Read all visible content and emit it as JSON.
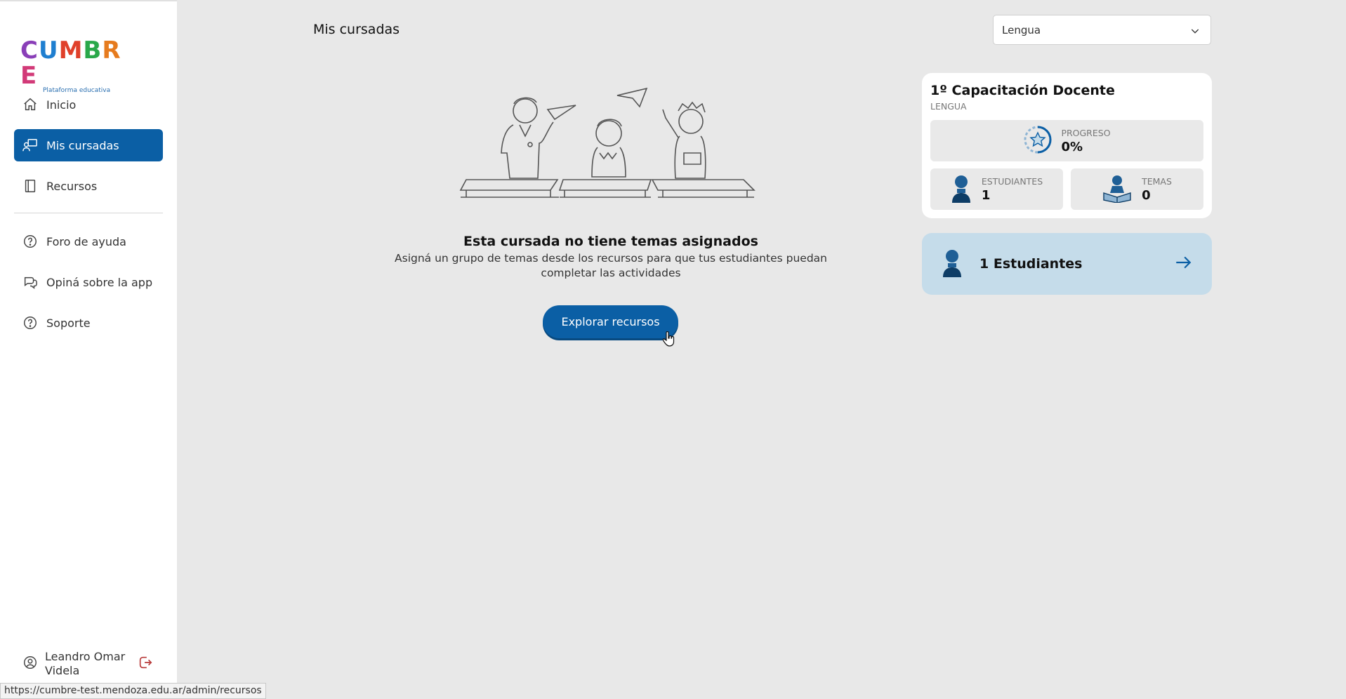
{
  "sidebar": {
    "logo": {
      "text": "CUMBRE",
      "subtitle": "Plataforma educativa"
    },
    "items": [
      {
        "label": "Inicio",
        "icon": "home-icon"
      },
      {
        "label": "Mis cursadas",
        "icon": "classroom-icon",
        "active": true
      },
      {
        "label": "Recursos",
        "icon": "book-icon"
      },
      {
        "label": "Foro de ayuda",
        "icon": "help-icon"
      },
      {
        "label": "Opiná sobre la app",
        "icon": "chat-icon"
      },
      {
        "label": "Soporte",
        "icon": "help-icon"
      }
    ],
    "user": {
      "name": "Leandro Omar Videla"
    }
  },
  "header": {
    "title": "Mis cursadas",
    "subject_select": {
      "value": "Lengua"
    }
  },
  "empty_state": {
    "title": "Esta cursada no tiene temas asignados",
    "description": "Asigná un grupo de temas desde los recursos para que tus estudiantes puedan completar las actividades",
    "button_label": "Explorar recursos"
  },
  "course": {
    "title": "1º Capacitación Docente",
    "subject": "LENGUA",
    "progress": {
      "label": "PROGRESO",
      "value": "0%"
    },
    "students": {
      "label": "ESTUDIANTES",
      "value": "1"
    },
    "topics": {
      "label": "TEMAS",
      "value": "0"
    }
  },
  "students_link": {
    "label": "1 Estudiantes"
  },
  "status_bar": {
    "url": "https://cumbre-test.mendoza.edu.ar/admin/recursos"
  },
  "colors": {
    "primary": "#0b5fa5",
    "card_blue": "#c5dcea",
    "background": "#e8e8e8"
  }
}
